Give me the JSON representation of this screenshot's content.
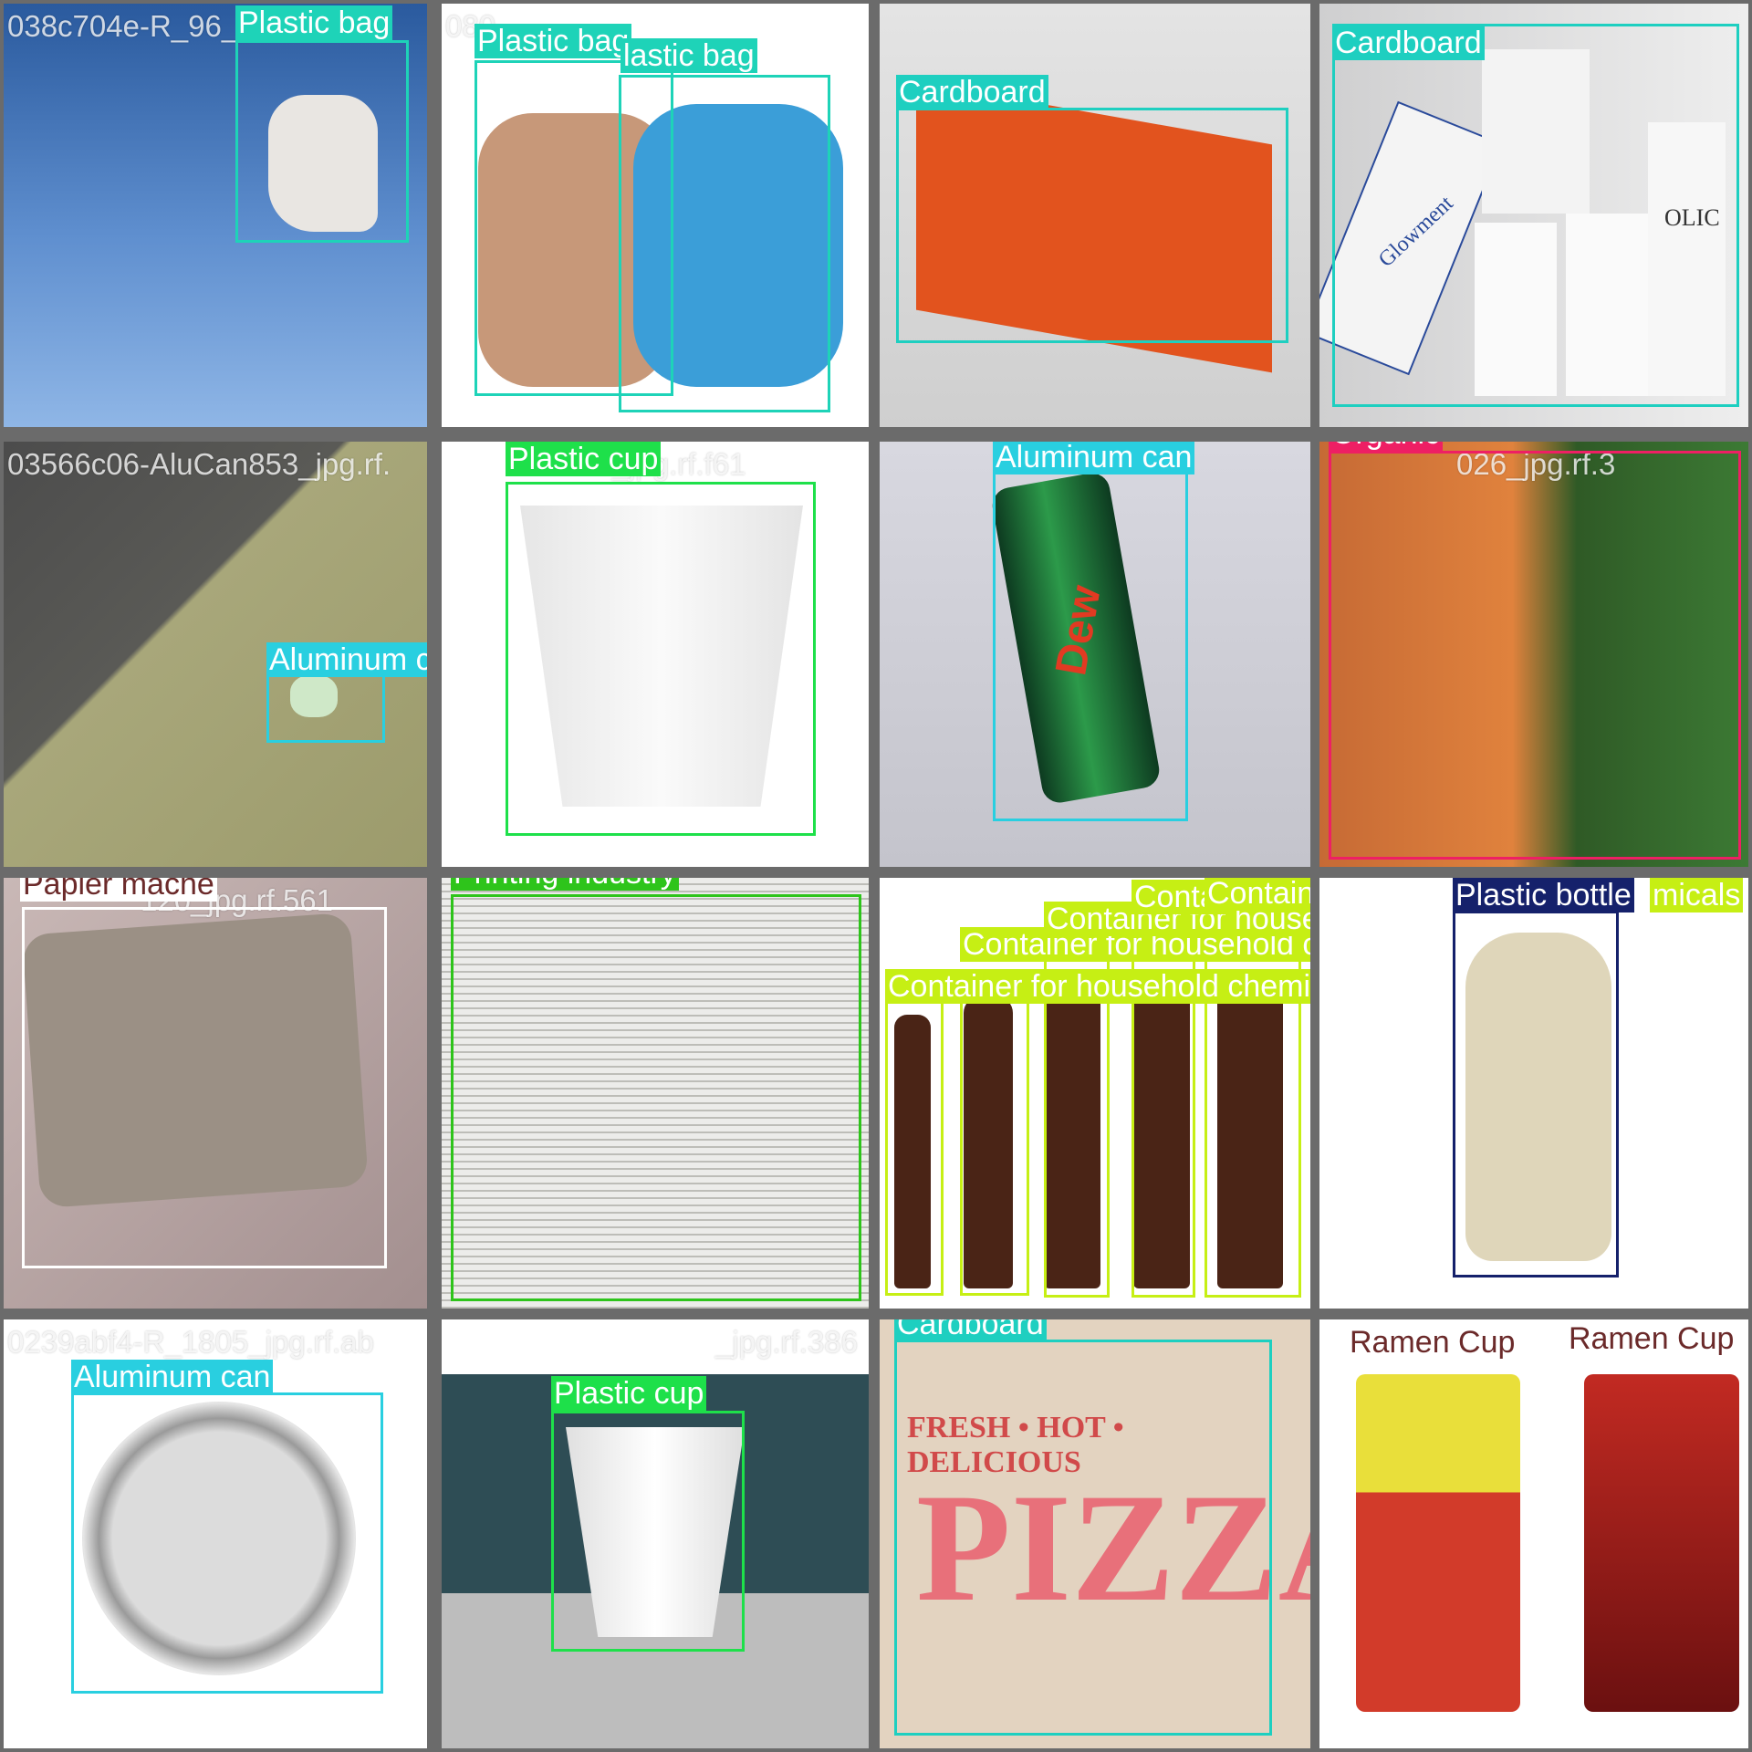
{
  "colors": {
    "plastic_bag": "#1ed3b8",
    "cardboard": "#1ecfc0",
    "aluminum_can": "#29cfe0",
    "organic": "#ee1f64",
    "plastic_cup": "#1ee04a",
    "papier_mache": "#ffffff",
    "printing_industry": "#2ec41b",
    "container_household": "#c6ef14",
    "plastic_bottle": "#15216b",
    "ramen_cup": "#ffffff"
  },
  "tiles": [
    {
      "filename": "038c704e-R_96_",
      "labels": [
        "Plastic bag"
      ]
    },
    {
      "filename": "080",
      "labels": [
        "Plastic bag",
        "lastic bag"
      ]
    },
    {
      "filename": "",
      "labels": [
        "Cardboard"
      ]
    },
    {
      "filename": "",
      "labels": [
        "Cardboard"
      ]
    },
    {
      "filename": "03566c06-AluCan853_jpg.rf.",
      "labels": [
        "Aluminum can"
      ]
    },
    {
      "filename": "42_jpg.rf.f61",
      "labels": [
        "Plastic cup"
      ]
    },
    {
      "filename": "",
      "labels": [
        "Aluminum can"
      ]
    },
    {
      "filename": "026_jpg.rf.3",
      "labels": [
        "Organic"
      ]
    },
    {
      "filename": "120_jpg.rf.561",
      "labels": [
        "Papier mache"
      ]
    },
    {
      "filename": "",
      "labels": [
        "Printing industry"
      ]
    },
    {
      "filename": "",
      "labels": [
        "Container for household chemicals",
        "Container for household chemicals",
        "Container for household chemicals",
        "Contai",
        "Container for he"
      ]
    },
    {
      "filename": "",
      "labels": [
        "Plastic bottle",
        "micals"
      ]
    },
    {
      "filename": "0239abf4-R_1805_jpg.rf.ab",
      "labels": [
        "Aluminum can"
      ]
    },
    {
      "filename": "_jpg.rf.386",
      "labels": [
        "Plastic cup"
      ]
    },
    {
      "filename": "",
      "labels": [
        "Cardboard"
      ]
    },
    {
      "filename": "",
      "labels": [
        "Ramen Cup",
        "Ramen Cup"
      ]
    }
  ],
  "pizza_box": {
    "line1": "FRESH • HOT • DELICIOUS",
    "word": "PIZZA"
  },
  "mew_text": "Dew",
  "glowment": "Glowment",
  "olic": "OLIC"
}
